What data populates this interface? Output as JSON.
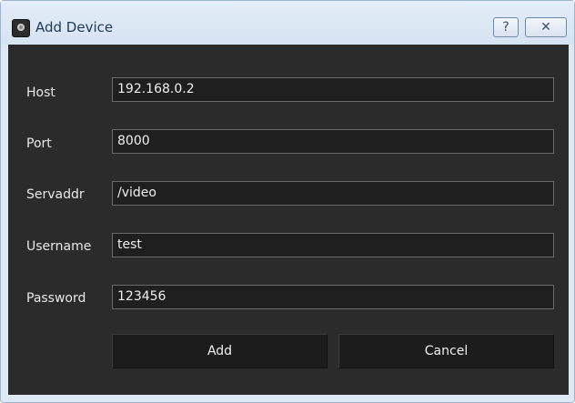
{
  "window": {
    "title": "Add Device",
    "help_glyph": "?",
    "close_glyph": "✕"
  },
  "form": {
    "fields": [
      {
        "label": "Host",
        "value": "192.168.0.2"
      },
      {
        "label": "Port",
        "value": "8000"
      },
      {
        "label": "Servaddr",
        "value": "/video"
      },
      {
        "label": "Username",
        "value": "test"
      },
      {
        "label": "Password",
        "value": "123456"
      }
    ]
  },
  "buttons": {
    "add_label": "Add",
    "cancel_label": "Cancel"
  },
  "icons": {
    "app": "camera-app-icon",
    "help": "help-icon",
    "close": "close-icon"
  }
}
